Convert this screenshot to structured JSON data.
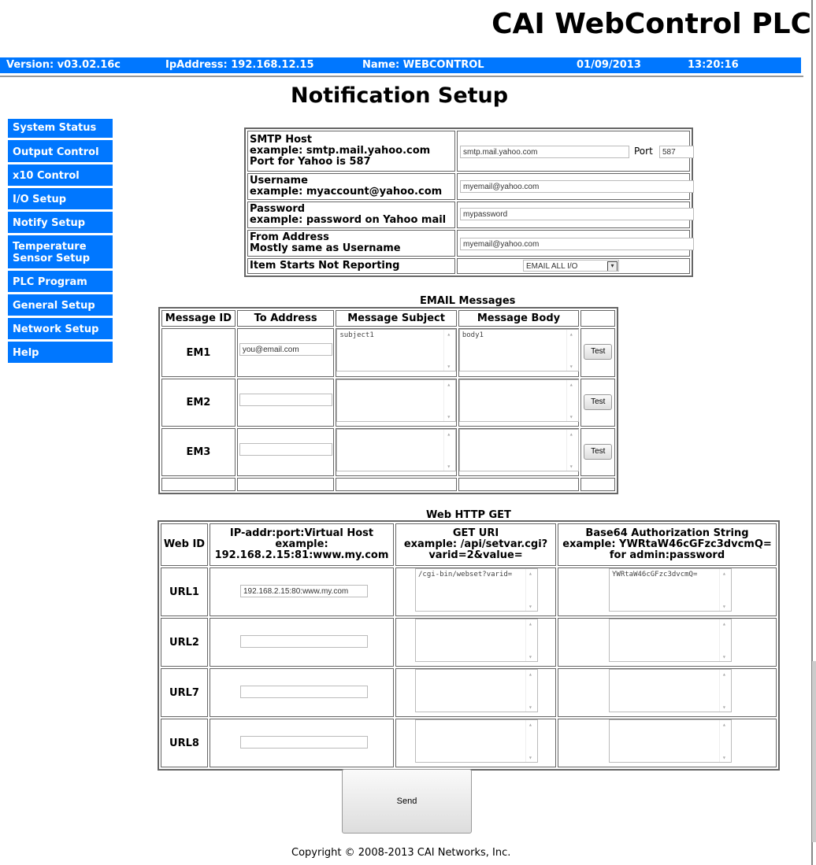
{
  "app": {
    "title": "CAI WebControl PLC"
  },
  "status": {
    "version": "Version: v03.02.16c",
    "ip": "IpAddress: 192.168.12.15",
    "name": "Name: WEBCONTROL",
    "date": "01/09/2013",
    "time": "13:20:16"
  },
  "page": {
    "title": "Notification Setup"
  },
  "sidebar": {
    "items": [
      {
        "label": "System Status"
      },
      {
        "label": "Output Control"
      },
      {
        "label": "x10 Control"
      },
      {
        "label": "I/O Setup"
      },
      {
        "label": "Notify Setup"
      },
      {
        "label": "Temperature Sensor Setup"
      },
      {
        "label": "PLC Program"
      },
      {
        "label": "General Setup"
      },
      {
        "label": "Network Setup"
      },
      {
        "label": "Help"
      }
    ]
  },
  "smtp": {
    "host_label_1": "SMTP Host",
    "host_label_2": "example: smtp.mail.yahoo.com",
    "host_label_3": "Port for Yahoo is 587",
    "host_value": "smtp.mail.yahoo.com",
    "port_label": "Port",
    "port_value": "587",
    "user_label_1": "Username",
    "user_label_2": "example: myaccount@yahoo.com",
    "user_value": "myemail@yahoo.com",
    "pass_label_1": "Password",
    "pass_label_2": "example: password on Yahoo mail",
    "pass_value": "mypassword",
    "from_label_1": "From Address",
    "from_label_2": "Mostly same as Username",
    "from_value": "myemail@yahoo.com",
    "item_label": "Item Starts Not Reporting",
    "item_value": "EMAIL ALL I/O"
  },
  "email": {
    "title": "EMAIL Messages",
    "headers": [
      "Message ID",
      "To Address",
      "Message Subject",
      "Message Body"
    ],
    "rows": [
      {
        "id": "EM1",
        "to": "you@email.com",
        "subject": "subject1",
        "body": "body1",
        "test": "Test"
      },
      {
        "id": "EM2",
        "to": "",
        "subject": "",
        "body": "",
        "test": "Test"
      },
      {
        "id": "EM3",
        "to": "",
        "subject": "",
        "body": "",
        "test": "Test"
      }
    ]
  },
  "http": {
    "title": "Web HTTP GET",
    "h_id": "Web ID",
    "h_ip_1": "IP-addr:port:Virtual Host",
    "h_ip_2": "example:",
    "h_ip_3": "192.168.2.15:81:www.my.com",
    "h_uri_1": "GET URI",
    "h_uri_2": "example:  /api/setvar.cgi?",
    "h_uri_3": "varid=2&value=",
    "h_auth_1": "Base64 Authorization String",
    "h_auth_2": "example: YWRtaW46cGFzc3dvcmQ=",
    "h_auth_3": "for admin:password",
    "rows": [
      {
        "id": "URL1",
        "ip": "192.168.2.15:80:www.my.com",
        "uri": "/cgi-bin/webset?varid=",
        "auth": "YWRtaW46cGFzc3dvcmQ="
      },
      {
        "id": "URL2",
        "ip": "",
        "uri": "",
        "auth": ""
      },
      {
        "id": "URL7",
        "ip": "",
        "uri": "",
        "auth": ""
      },
      {
        "id": "URL8",
        "ip": "",
        "uri": "",
        "auth": ""
      }
    ]
  },
  "send_label": "Send",
  "copyright": "Copyright © 2008-2013 CAI Networks, Inc."
}
